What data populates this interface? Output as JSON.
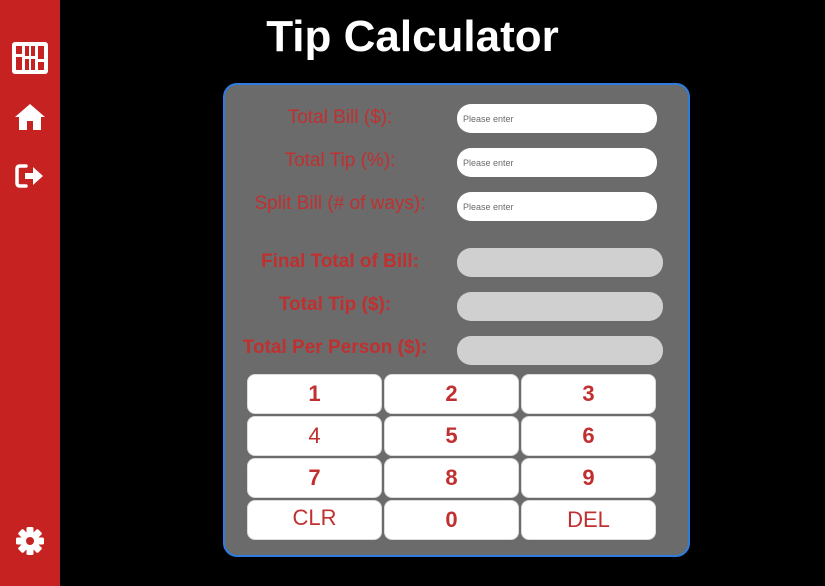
{
  "app": {
    "title": "Tip Calculator"
  },
  "sidebar": {
    "items": [
      {
        "name": "logo",
        "icon": "grid-logo-icon"
      },
      {
        "name": "home",
        "icon": "home-icon"
      },
      {
        "name": "logout",
        "icon": "logout-icon"
      },
      {
        "name": "settings",
        "icon": "gear-icon"
      }
    ]
  },
  "form": {
    "total_bill": {
      "label": "Total Bill ($):",
      "placeholder": "Please enter",
      "value": ""
    },
    "total_tip_pct": {
      "label": "Total Tip (%):",
      "placeholder": "Please enter",
      "value": ""
    },
    "split_bill": {
      "label": "Split Bill (# of ways):",
      "placeholder": "Please enter",
      "value": ""
    }
  },
  "results": {
    "final_total": {
      "label": "Final Total of Bill:",
      "value": ""
    },
    "total_tip": {
      "label": "Total Tip ($):",
      "value": ""
    },
    "per_person": {
      "label": "Total Per Person ($):",
      "value": ""
    }
  },
  "keypad": {
    "keys": [
      "1",
      "2",
      "3",
      "4",
      "5",
      "6",
      "7",
      "8",
      "9",
      "CLR",
      "0",
      "DEL"
    ]
  },
  "colors": {
    "sidebar": "#c62222",
    "accent_text": "#c03030",
    "panel": "#6b6b6b",
    "panel_border": "#2f7ce0",
    "background": "#000000"
  }
}
